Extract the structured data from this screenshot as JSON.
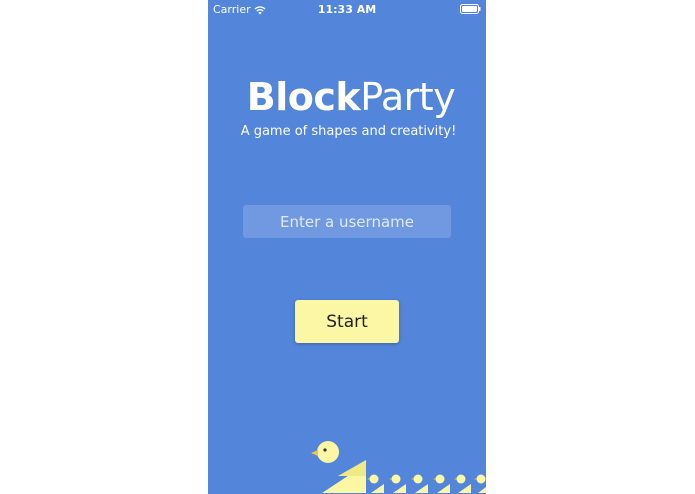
{
  "status_bar": {
    "carrier": "Carrier",
    "time": "11:33 AM",
    "wifi_icon": "wifi-icon",
    "battery_icon": "battery-icon"
  },
  "app": {
    "title_bold": "Block",
    "title_light": "Party",
    "subtitle": "A game of shapes and creativity!",
    "username_placeholder": "Enter a username",
    "username_value": "",
    "start_label": "Start"
  },
  "decoration": {
    "duck_icon": "duck-icon",
    "duck_count_large": 1,
    "duck_count_small": 6
  },
  "colors": {
    "background": "#5385db",
    "button": "#fbf7a5",
    "duck_body": "#fbf7a5",
    "duck_beak": "#f6c24a"
  }
}
